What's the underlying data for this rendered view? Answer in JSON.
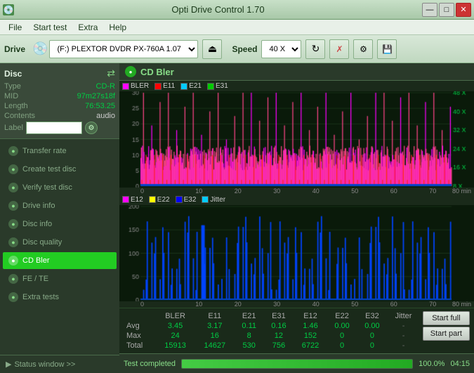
{
  "titlebar": {
    "title": "Opti Drive Control 1.70",
    "icon": "💿",
    "controls": {
      "minimize": "—",
      "restore": "□",
      "close": "✕"
    }
  },
  "menubar": {
    "items": [
      "File",
      "Start test",
      "Extra",
      "Help"
    ]
  },
  "toolbar": {
    "drive_label": "Drive",
    "drive_value": "(F:)  PLEXTOR DVDR  PX-760A 1.07",
    "speed_label": "Speed",
    "speed_value": "40 X"
  },
  "sidebar": {
    "disc_title": "Disc",
    "disc_fields": {
      "type_label": "Type",
      "type_value": "CD-R",
      "mid_label": "MID",
      "mid_value": "97m27s18f",
      "length_label": "Length",
      "length_value": "76:53.25",
      "contents_label": "Contents",
      "contents_value": "audio",
      "label_label": "Label"
    },
    "menu_items": [
      {
        "id": "transfer-rate",
        "label": "Transfer rate",
        "active": false
      },
      {
        "id": "create-test-disc",
        "label": "Create test disc",
        "active": false
      },
      {
        "id": "verify-test-disc",
        "label": "Verify test disc",
        "active": false
      },
      {
        "id": "drive-info",
        "label": "Drive info",
        "active": false
      },
      {
        "id": "disc-info",
        "label": "Disc info",
        "active": false
      },
      {
        "id": "disc-quality",
        "label": "Disc quality",
        "active": false
      },
      {
        "id": "cd-bler",
        "label": "CD Bler",
        "active": true
      },
      {
        "id": "fe-te",
        "label": "FE / TE",
        "active": false
      },
      {
        "id": "extra-tests",
        "label": "Extra tests",
        "active": false
      }
    ],
    "status_window": "Status window >>"
  },
  "cdbler": {
    "title": "CD Bler",
    "top_legend": [
      "BLER",
      "E11",
      "E21",
      "E31"
    ],
    "top_legend_colors": [
      "#ff00ff",
      "#ff0000",
      "#00ccff",
      "#ffff00"
    ],
    "bottom_legend": [
      "E12",
      "E22",
      "E32",
      "Jitter"
    ],
    "bottom_legend_colors": [
      "#ff00ff",
      "#ffff00",
      "#0000ff",
      "#00ccff"
    ],
    "top_y_labels": [
      "30",
      "25",
      "20",
      "15",
      "10",
      "5",
      "0"
    ],
    "top_y_right": [
      "48 X",
      "40 X",
      "32 X",
      "24 X",
      "16 X",
      "8 X"
    ],
    "bottom_y_labels": [
      "200",
      "150",
      "100",
      "50",
      "0"
    ],
    "x_labels": [
      "0",
      "10",
      "20",
      "30",
      "40",
      "50",
      "60",
      "70",
      "80 min"
    ]
  },
  "stats": {
    "columns": [
      "",
      "BLER",
      "E11",
      "E21",
      "E31",
      "E12",
      "E22",
      "E32",
      "Jitter",
      ""
    ],
    "rows": [
      {
        "label": "Avg",
        "values": [
          "3.45",
          "3.17",
          "0.11",
          "0.16",
          "1.46",
          "0.00",
          "0.00",
          "-"
        ]
      },
      {
        "label": "Max",
        "values": [
          "24",
          "16",
          "8",
          "12",
          "152",
          "0",
          "0",
          "-"
        ]
      },
      {
        "label": "Total",
        "values": [
          "15913",
          "14627",
          "530",
          "756",
          "6722",
          "0",
          "0",
          "-"
        ]
      }
    ],
    "buttons": [
      "Start full",
      "Start part"
    ]
  },
  "statusbar": {
    "text": "Test completed",
    "progress": 100.0,
    "progress_label": "100.0%",
    "time": "04:15"
  }
}
